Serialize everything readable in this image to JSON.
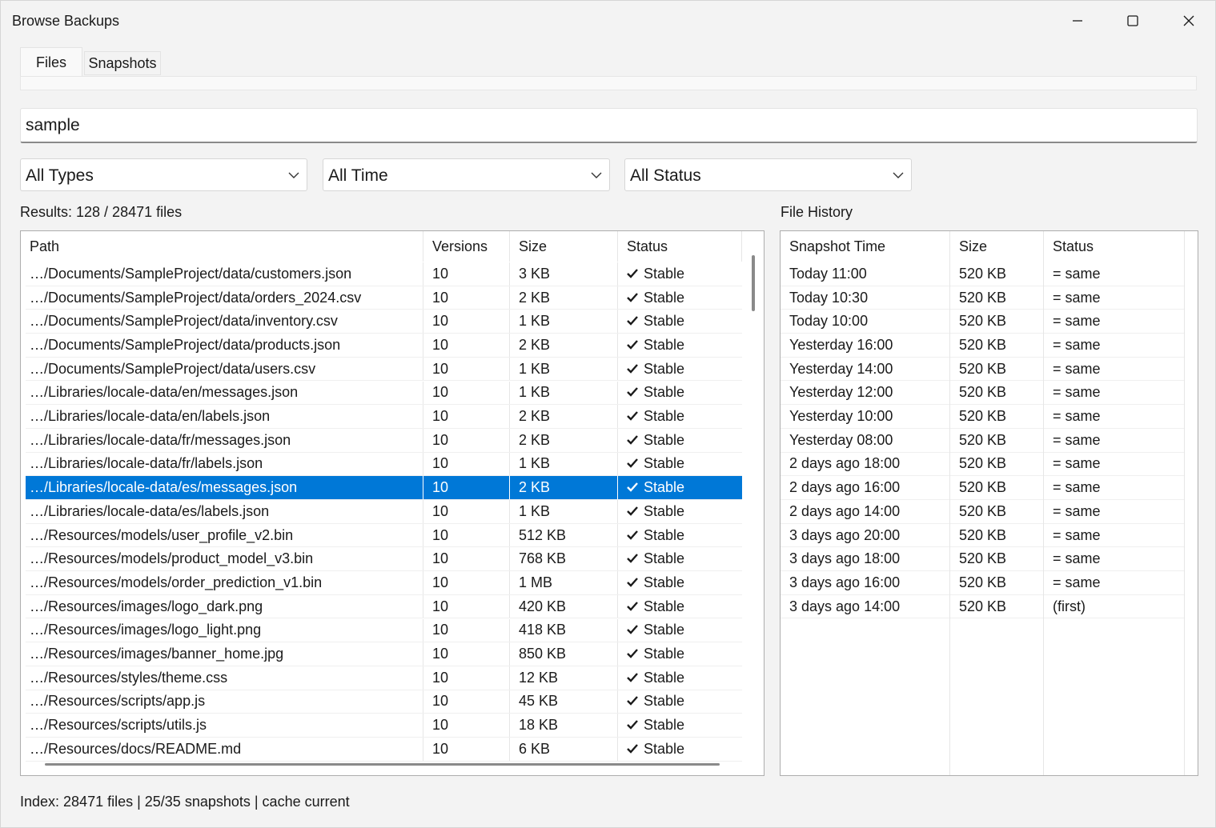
{
  "window": {
    "title": "Browse Backups"
  },
  "tabs": {
    "files": "Files",
    "snapshots": "Snapshots"
  },
  "search": {
    "value": "sample"
  },
  "filters": {
    "types": "All Types",
    "time": "All Time",
    "status": "All Status"
  },
  "results_label": "Results: 128 / 28471 files",
  "history_label": "File History",
  "files": {
    "columns": [
      "Path",
      "Versions",
      "Size",
      "Status"
    ],
    "selected_index": 9,
    "rows": [
      [
        "…/Documents/SampleProject/data/customers.json",
        "10",
        "3 KB",
        "Stable"
      ],
      [
        "…/Documents/SampleProject/data/orders_2024.csv",
        "10",
        "2 KB",
        "Stable"
      ],
      [
        "…/Documents/SampleProject/data/inventory.csv",
        "10",
        "1 KB",
        "Stable"
      ],
      [
        "…/Documents/SampleProject/data/products.json",
        "10",
        "2 KB",
        "Stable"
      ],
      [
        "…/Documents/SampleProject/data/users.csv",
        "10",
        "1 KB",
        "Stable"
      ],
      [
        "…/Libraries/locale-data/en/messages.json",
        "10",
        "1 KB",
        "Stable"
      ],
      [
        "…/Libraries/locale-data/en/labels.json",
        "10",
        "2 KB",
        "Stable"
      ],
      [
        "…/Libraries/locale-data/fr/messages.json",
        "10",
        "2 KB",
        "Stable"
      ],
      [
        "…/Libraries/locale-data/fr/labels.json",
        "10",
        "1 KB",
        "Stable"
      ],
      [
        "…/Libraries/locale-data/es/messages.json",
        "10",
        "2 KB",
        "Stable"
      ],
      [
        "…/Libraries/locale-data/es/labels.json",
        "10",
        "1 KB",
        "Stable"
      ],
      [
        "…/Resources/models/user_profile_v2.bin",
        "10",
        "512 KB",
        "Stable"
      ],
      [
        "…/Resources/models/product_model_v3.bin",
        "10",
        "768 KB",
        "Stable"
      ],
      [
        "…/Resources/models/order_prediction_v1.bin",
        "10",
        "1 MB",
        "Stable"
      ],
      [
        "…/Resources/images/logo_dark.png",
        "10",
        "420 KB",
        "Stable"
      ],
      [
        "…/Resources/images/logo_light.png",
        "10",
        "418 KB",
        "Stable"
      ],
      [
        "…/Resources/images/banner_home.jpg",
        "10",
        "850 KB",
        "Stable"
      ],
      [
        "…/Resources/styles/theme.css",
        "10",
        "12 KB",
        "Stable"
      ],
      [
        "…/Resources/scripts/app.js",
        "10",
        "45 KB",
        "Stable"
      ],
      [
        "…/Resources/scripts/utils.js",
        "10",
        "18 KB",
        "Stable"
      ],
      [
        "…/Resources/docs/README.md",
        "10",
        "6 KB",
        "Stable"
      ]
    ]
  },
  "history": {
    "columns": [
      "Snapshot Time",
      "Size",
      "Status"
    ],
    "rows": [
      [
        "Today 11:00",
        "520 KB",
        "= same"
      ],
      [
        "Today 10:30",
        "520 KB",
        "= same"
      ],
      [
        "Today 10:00",
        "520 KB",
        "= same"
      ],
      [
        "Yesterday 16:00",
        "520 KB",
        "= same"
      ],
      [
        "Yesterday 14:00",
        "520 KB",
        "= same"
      ],
      [
        "Yesterday 12:00",
        "520 KB",
        "= same"
      ],
      [
        "Yesterday 10:00",
        "520 KB",
        "= same"
      ],
      [
        "Yesterday 08:00",
        "520 KB",
        "= same"
      ],
      [
        "2 days ago 18:00",
        "520 KB",
        "= same"
      ],
      [
        "2 days ago 16:00",
        "520 KB",
        "= same"
      ],
      [
        "2 days ago 14:00",
        "520 KB",
        "= same"
      ],
      [
        "3 days ago 20:00",
        "520 KB",
        "= same"
      ],
      [
        "3 days ago 18:00",
        "520 KB",
        "= same"
      ],
      [
        "3 days ago 16:00",
        "520 KB",
        "= same"
      ],
      [
        "3 days ago 14:00",
        "520 KB",
        "(first)"
      ]
    ]
  },
  "statusbar": "Index: 28471 files | 25/35 snapshots | cache current",
  "colors": {
    "selection": "#0078d7",
    "window_bg": "#f3f3f3"
  }
}
